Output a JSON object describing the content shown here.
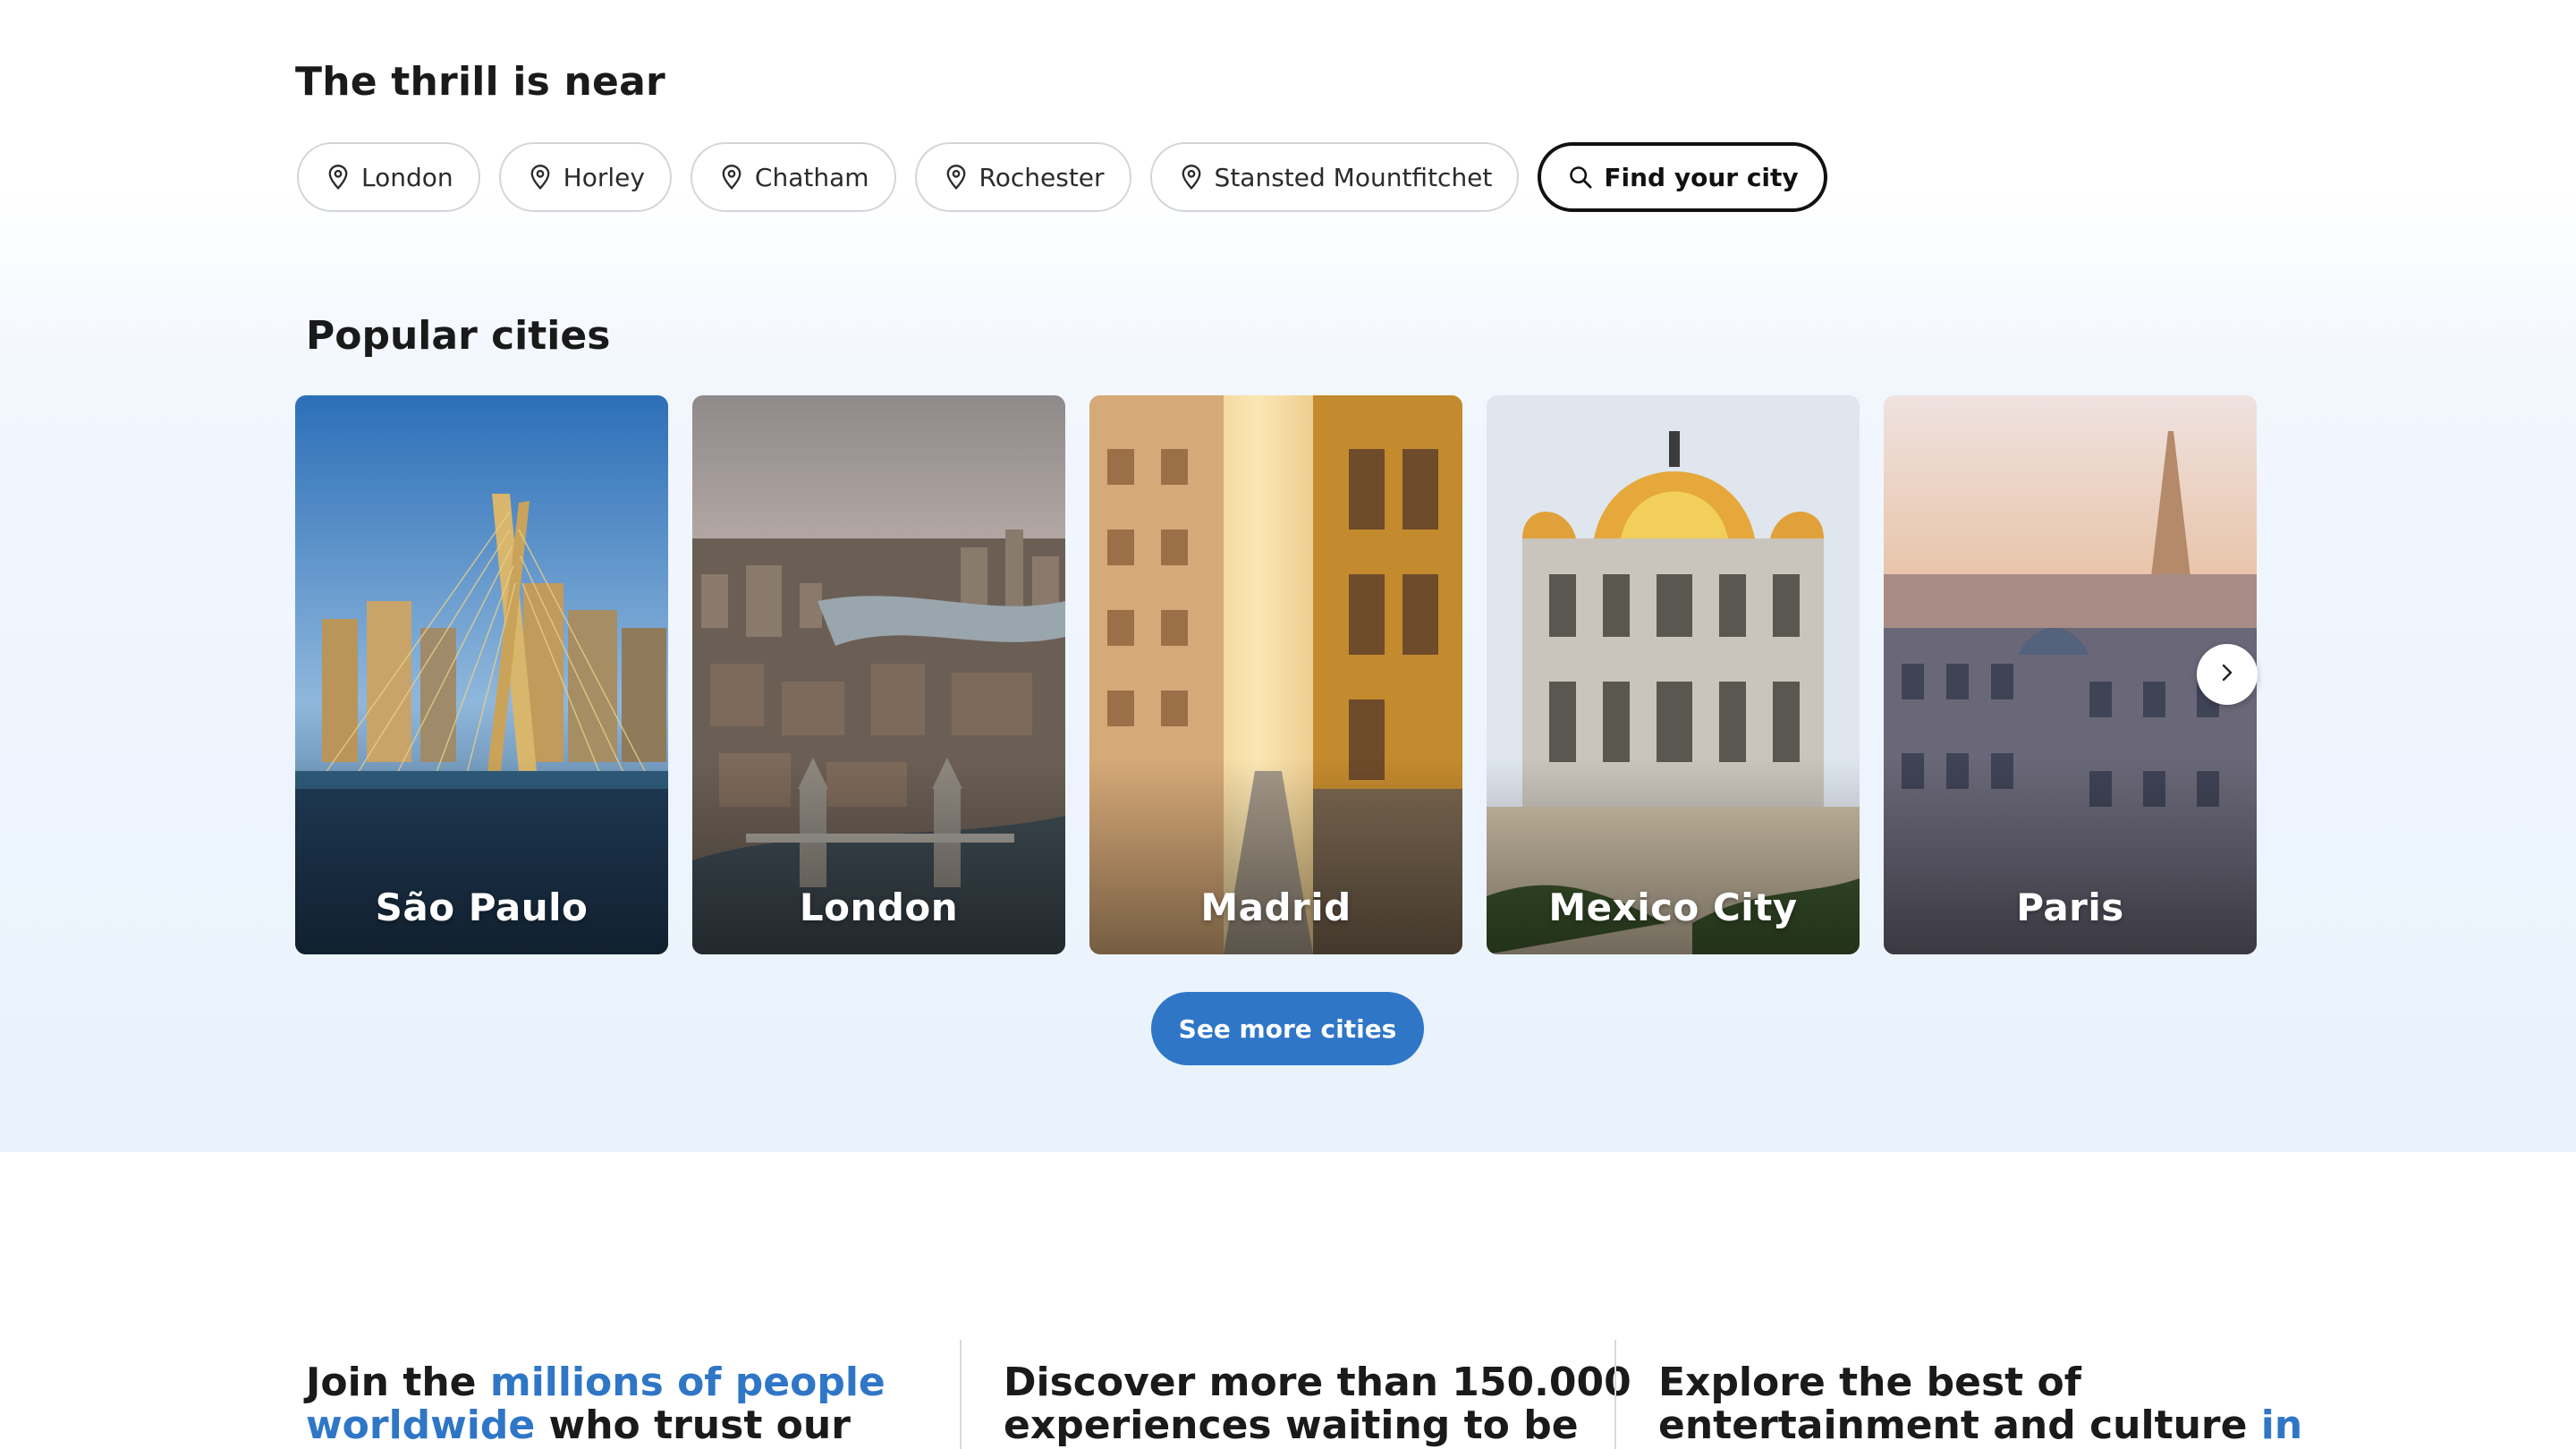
{
  "near": {
    "title": "The thrill is near",
    "cities": [
      "London",
      "Horley",
      "Chatham",
      "Rochester",
      "Stansted Mountfitchet"
    ],
    "find_label": "Find your city"
  },
  "popular": {
    "title": "Popular cities",
    "cards": [
      {
        "name": "São Paulo"
      },
      {
        "name": "London"
      },
      {
        "name": "Madrid"
      },
      {
        "name": "Mexico City"
      },
      {
        "name": "Paris"
      }
    ],
    "see_more_label": "See more cities"
  },
  "stats": {
    "col1": {
      "pre": "Join the ",
      "accent": "millions of people",
      "line2_accent": "worldwide",
      "line2_rest": " who trust our"
    },
    "col2": {
      "line1": "Discover more than 150.000",
      "line2": "experiences waiting to be"
    },
    "col3": {
      "line1": "Explore the best of",
      "line2_pre": "entertainment and culture ",
      "line2_accent": "in"
    }
  },
  "colors": {
    "accent": "#2f76c7",
    "chip_border": "#d3d5d8"
  },
  "icons": {
    "chip": "map-pin-icon",
    "find": "search-icon",
    "next": "chevron-right-icon"
  }
}
